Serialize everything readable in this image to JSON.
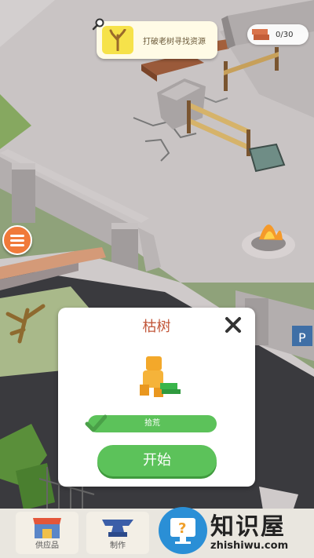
{
  "quest": {
    "text": "打破老树寻找资源",
    "icon": "dead-tree-icon"
  },
  "resources": {
    "count": "0/30",
    "icon": "brick-icon"
  },
  "menu": {
    "icon": "hamburger-icon"
  },
  "dialog": {
    "title": "枯树",
    "task_label": "拾荒",
    "start_label": "开始",
    "close_icon": "close-icon"
  },
  "tabs": [
    {
      "label": "供应品",
      "icon": "shop-icon"
    },
    {
      "label": "制作",
      "icon": "anvil-icon"
    },
    {
      "label": "",
      "icon": "help-monitor-icon"
    }
  ],
  "watermark": {
    "text": "知识屋",
    "sub": "zhishiwu.com"
  },
  "signs": {
    "parking": "P"
  },
  "colors": {
    "accent_green": "#5cc25a",
    "title_red": "#c2573a",
    "menu_orange": "#f07a3a"
  }
}
